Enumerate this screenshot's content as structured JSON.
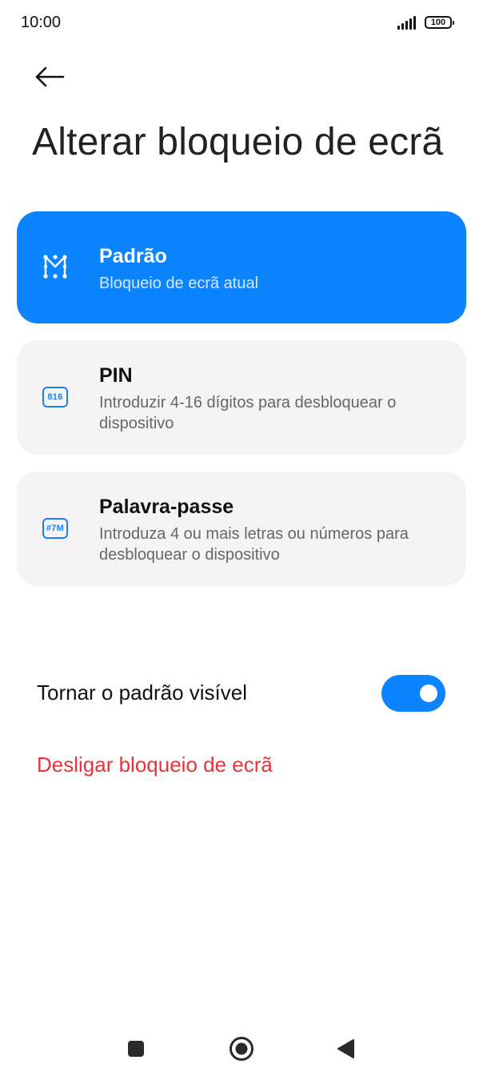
{
  "status_bar": {
    "time": "10:00",
    "battery": "100",
    "icons": [
      "signal-icon",
      "battery-icon"
    ]
  },
  "header": {
    "back_icon": "arrow-left-icon",
    "title": "Alterar bloqueio de ecrã"
  },
  "options": [
    {
      "icon": "pattern-icon",
      "title": "Padrão",
      "description": "Bloqueio de ecrã atual",
      "selected": true
    },
    {
      "icon": "pin-icon",
      "icon_text": "816",
      "title": "PIN",
      "description": "Introduzir 4-16 dígitos para desbloquear o dispositivo",
      "selected": false
    },
    {
      "icon": "password-icon",
      "icon_text": "#7M",
      "title": "Palavra-passe",
      "description": "Introduza 4 ou mais letras ou números para desbloquear o dispositivo",
      "selected": false
    }
  ],
  "settings": {
    "visible_pattern_label": "Tornar o padrão visível",
    "visible_pattern_on": true,
    "disable_lock_label": "Desligar bloqueio de ecrã"
  },
  "nav_bar": {
    "recents_icon": "square-icon",
    "home_icon": "circle-home-icon",
    "back_icon": "triangle-back-icon"
  },
  "colors": {
    "accent": "#0d84ff",
    "card_bg": "#f4f4f4",
    "danger": "#e8333a"
  }
}
